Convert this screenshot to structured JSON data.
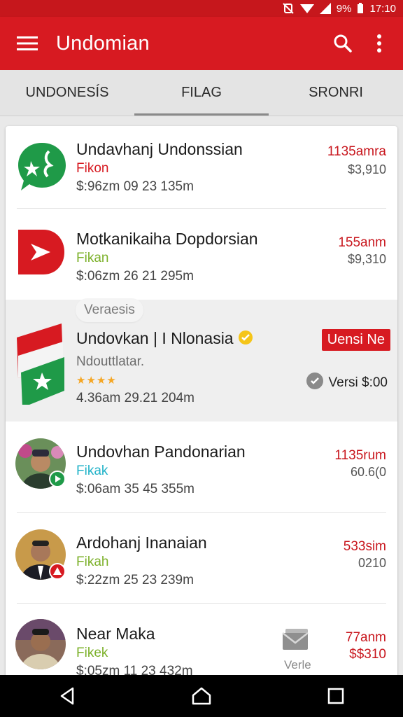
{
  "status": {
    "battery": "9%",
    "time": "17:10"
  },
  "appbar": {
    "title": "Undomian",
    "menu_icon": "hamburger-menu-icon",
    "search_icon": "search-icon",
    "more_icon": "more-vert-icon"
  },
  "tabs": [
    {
      "label": "UNDONESÍS",
      "active": false
    },
    {
      "label": "FILAG",
      "active": true
    },
    {
      "label": "SRONRI",
      "active": false
    }
  ],
  "items": [
    {
      "name": "Undavhanj Undonssian",
      "sub": "Fikon",
      "sub_color": "#d71a21",
      "meta": "$:96zm  09 23 135m",
      "amount": "1135amra",
      "value": "$3,910",
      "icon": "chat-bubble-logo-icon"
    },
    {
      "name": "Motkanikaiha Dopdorsian",
      "sub": "Fikan",
      "sub_color": "#7cb12a",
      "meta": "$:06zm  26 21 295m",
      "amount": "155anm",
      "value": "$9,310",
      "icon": "red-play-logo-icon"
    },
    {
      "name": "Undovkan | I Nlonasia",
      "sub": "Ndouttlatar.",
      "sub_color": "#6d6d6d",
      "meta": "4.36am  29.21 204m",
      "chip": "Veraesis",
      "badge": "Uensi Ne",
      "versi": "Versi $:00",
      "stars": "★★★★",
      "icon": "flag-logo-icon",
      "verified_icon": "verified-badge-icon",
      "check_icon": "check-circle-icon"
    },
    {
      "name": "Undovhan Pandonarian",
      "sub": "Fikak",
      "sub_color": "#23b3c9",
      "meta": "$:06am  35 45 355m",
      "amount": "1135rum",
      "value": "60.6(0",
      "icon": "profile-photo-icon"
    },
    {
      "name": "Ardohanj Inanaian",
      "sub": "Fikah",
      "sub_color": "#7cb12a",
      "meta": "$:22zm  25 23 239m",
      "amount": "533sim",
      "value": "0210",
      "icon": "profile-photo-icon"
    },
    {
      "name": "Near Maka",
      "sub": "Fikek",
      "sub_color": "#7cb12a",
      "meta": "$:05zm  11 23 432m",
      "amount": "77anm",
      "value": "$$310",
      "overlay_label": "Verle",
      "icon": "profile-photo-icon",
      "overlay_icon": "mail-stack-icon"
    }
  ],
  "navbar": {
    "back_icon": "back-triangle-icon",
    "home_icon": "home-icon",
    "recents_icon": "recents-square-icon"
  },
  "colors": {
    "primary": "#d71a21",
    "accent_green": "#7cb12a",
    "accent_cyan": "#23b3c9"
  }
}
